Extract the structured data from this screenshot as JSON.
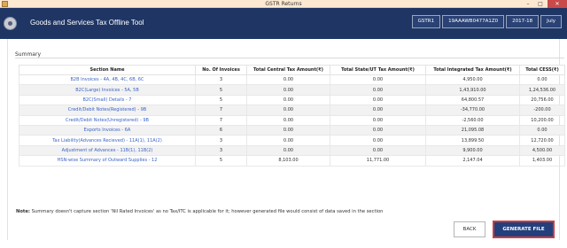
{
  "window": {
    "title": "GSTR Returns",
    "minimize": "–",
    "maximize": "□",
    "close": "✕"
  },
  "header": {
    "app_title": "Goods and Services Tax Offline Tool",
    "return_type": "GSTR1",
    "gstin": "19AAAWB0477A1Z0",
    "fy": "2017-18",
    "month": "July"
  },
  "summary": {
    "title": "Summary",
    "columns": [
      "Section Name",
      "No. Of Invoices",
      "Total Central Tax Amount(₹)",
      "Total State/UT Tax Amount(₹)",
      "Total Integrated Tax Amount(₹)",
      "Total CESS(₹)"
    ],
    "rows": [
      [
        "B2B Invoices - 4A, 4B, 4C, 6B, 6C",
        "3",
        "0.00",
        "0.00",
        "4,950.00",
        "0.00"
      ],
      [
        "B2C(Large) Invoices - 5A, 5B",
        "5",
        "0.00",
        "0.00",
        "1,43,910.00",
        "1,24,536.00"
      ],
      [
        "B2C(Small) Details - 7",
        "5",
        "0.00",
        "0.00",
        "64,800.57",
        "20,756.00"
      ],
      [
        "Credit/Debit Notes(Registered) - 9B",
        "7",
        "0.00",
        "0.00",
        "-34,770.00",
        "-200.00"
      ],
      [
        "Credit/Debit Notes(Unregistered) - 9B",
        "7",
        "0.00",
        "0.00",
        "-2,560.00",
        "10,200.00"
      ],
      [
        "Exports Invoices - 6A",
        "6",
        "0.00",
        "0.00",
        "21,095.08",
        "0.00"
      ],
      [
        "Tax Liability(Advances Recieved) - 11A(1), 11A(2)",
        "3",
        "0.00",
        "0.00",
        "13,899.50",
        "12,720.00"
      ],
      [
        "Adjustment of Advances - 11B(1), 11B(2)",
        "3",
        "0.00",
        "0.00",
        "9,900.00",
        "4,500.00"
      ],
      [
        "HSN-wise Summary of Outward Supplies - 12",
        "5",
        "8,103.00",
        "11,771.00",
        "2,147.04",
        "1,403.00"
      ]
    ]
  },
  "note": {
    "label": "Note:",
    "text": " Summary doesn't capture section 'Nil Rated Invoices' as no Tax/ITC is applicable for it; however generated file would consist of data saved in the section"
  },
  "buttons": {
    "back": "BACK",
    "generate": "GENERATE FILE"
  }
}
